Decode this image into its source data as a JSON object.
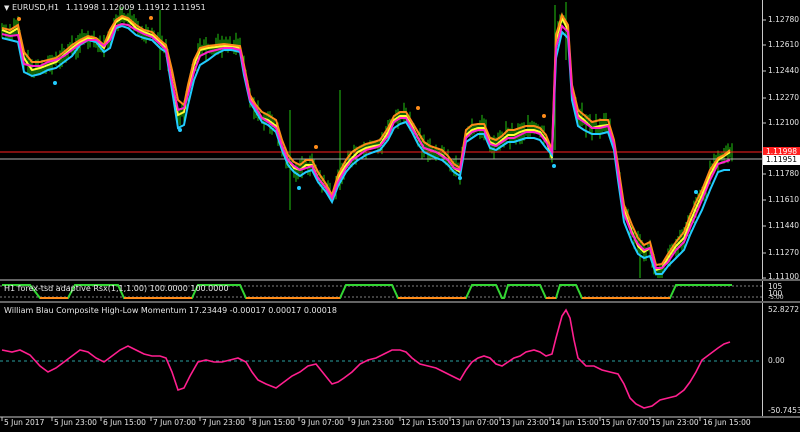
{
  "main_panel": {
    "symbol_label": "EURUSD,H1",
    "ohlc": "1.11998 1.12009 1.11912 1.11951",
    "price_ticks": [
      "1.12780",
      "1.12610",
      "1.12440",
      "1.12270",
      "1.12100",
      "1.11780",
      "1.11610",
      "1.11440",
      "1.11270",
      "1.11100"
    ],
    "current_price": "1.11951",
    "red_line_price": "1.11998"
  },
  "rsx_panel": {
    "title": "H1 forex-tsd adaptive Rsx(1,1,1.00) 100.0000 100.0000",
    "ticks": [
      "105",
      "100",
      "-5.00"
    ]
  },
  "momentum_panel": {
    "title": "William Blau Composite High-Low Momentum 17.23449 -0.00017 0.00017 0.00018",
    "ticks": [
      "52.8272",
      "0.00",
      "-50.7453"
    ]
  },
  "time_axis": [
    "5 Jun 2017",
    "5 Jun 23:00",
    "6 Jun 15:00",
    "7 Jun 07:00",
    "7 Jun 23:00",
    "8 Jun 15:00",
    "9 Jun 07:00",
    "9 Jun 23:00",
    "12 Jun 15:00",
    "13 Jun 07:00",
    "13 Jun 23:00",
    "14 Jun 15:00",
    "15 Jun 07:00",
    "15 Jun 23:00",
    "16 Jun 15:00"
  ],
  "colors": {
    "background": "#000000",
    "price_bars": "#22c40f",
    "line_yellow": "#ffff33",
    "line_cyan": "#22ccff",
    "line_orange": "#ff8c1a",
    "line_magenta": "#ff22cc",
    "momentum": "#ff1f8f",
    "red_line": "#ff2020",
    "rsx_green": "#33d633",
    "rsx_orange": "#ff8c1a",
    "dots_cyan": "#22ccff",
    "dots_orange": "#ff8c1a"
  },
  "icons": [
    "dropdown-triangle-icon"
  ]
}
